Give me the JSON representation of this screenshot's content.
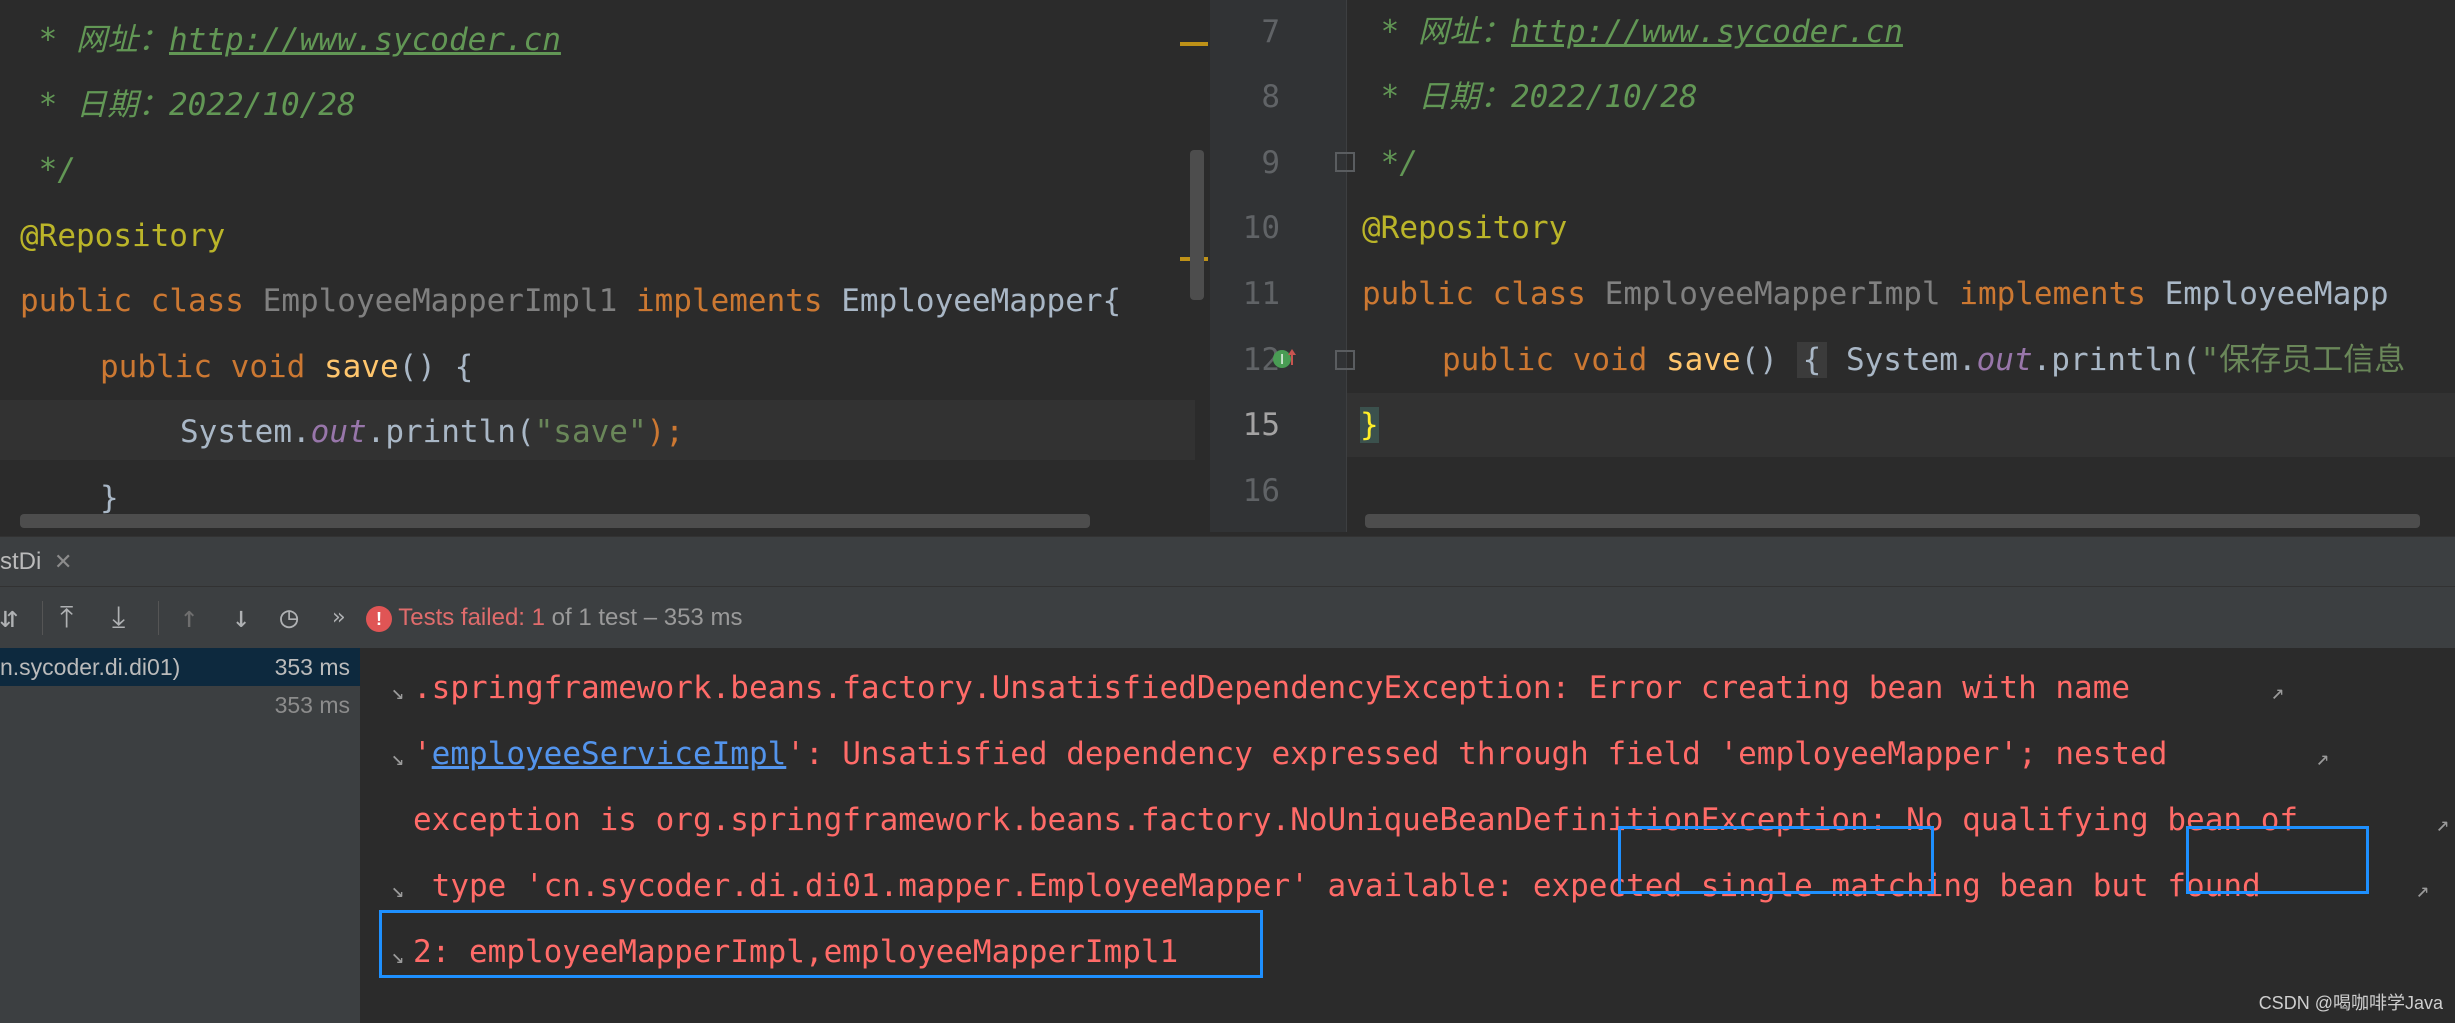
{
  "editor_left": {
    "lines": {
      "url_prefix": " * 网址：",
      "url": "http://www.sycoder.cn",
      "date": " * 日期：2022/10/28",
      "comment_end": " */",
      "annotation": "@Repository",
      "kw_public": "public",
      "kw_class": "class",
      "class_name": "EmployeeMapperImpl1",
      "kw_implements": "implements",
      "interface": "EmployeeMapper{",
      "kw_void": "void",
      "method": "save",
      "method_sig": "() {",
      "sys": "System.",
      "out": "out",
      "println": ".println(",
      "str_save": "\"save\"",
      "close_paren": ");",
      "brace": "}"
    }
  },
  "editor_right": {
    "line_numbers": [
      "7",
      "8",
      "9",
      "10",
      "11",
      "12",
      "15",
      "16"
    ],
    "lines": {
      "url_prefix": " * 网址：",
      "url": "http://www.sycoder.cn",
      "date": " * 日期：2022/10/28",
      "comment_end": " */",
      "annotation": "@Repository",
      "kw_public": "public",
      "kw_class": "class",
      "class_name": "EmployeeMapperImpl",
      "kw_implements": "implements",
      "interface": "EmployeeMapp",
      "kw_void": "void",
      "method": "save",
      "method_sig": "()",
      "fold_brace": "{",
      "sys": "System.",
      "out": "out",
      "println": ".println(",
      "str_part": "\"保存员工信息",
      "brace": "}"
    }
  },
  "tool_window": {
    "tab_label": "stDi",
    "status": {
      "failed_prefix": "Tests failed:",
      "failed_count": "1",
      "rest": "of 1 test – 353 ms"
    },
    "tree": [
      {
        "label": "n.sycoder.di.di01)",
        "time": "353 ms"
      },
      {
        "label": "",
        "time": "353 ms"
      }
    ]
  },
  "console": {
    "lines": [
      ".springframework.beans.factory.UnsatisfiedDependencyException: Error creating bean with name",
      "': Unsatisfied dependency expressed through field 'employeeMapper'; nested",
      "exception is org.springframework.beans.factory.NoUniqueBeanDefinitionException: No qualifying bean of",
      " type 'cn.sycoder.di.di01.mapper.EmployeeMapper' available: expected single matching bean but found",
      "2: employeeMapperImpl,employeeMapperImpl1"
    ],
    "line2_quote": "'",
    "line2_link": "employeeServiceImpl"
  },
  "watermark": "CSDN @喝咖啡学Java",
  "colors": {
    "error_red": "#ff6b68",
    "highlight_blue": "#1e90ff",
    "link_blue": "#5394ec"
  }
}
